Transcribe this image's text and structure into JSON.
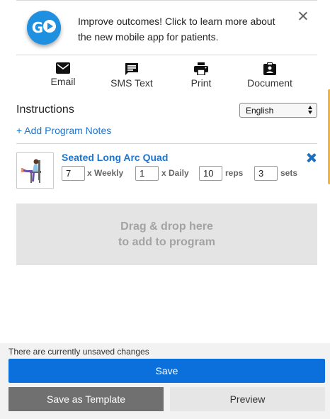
{
  "promo": {
    "badge_text": "GO",
    "text": "Improve outcomes! Click to learn more about the new mobile app for patients.",
    "close_icon": "close-icon"
  },
  "actions": [
    {
      "label": "Email",
      "icon": "email-icon"
    },
    {
      "label": "SMS Text",
      "icon": "sms-icon"
    },
    {
      "label": "Print",
      "icon": "print-icon"
    },
    {
      "label": "Document",
      "icon": "document-icon"
    }
  ],
  "instructions": {
    "title": "Instructions",
    "language": "English",
    "add_notes": "+ Add Program Notes"
  },
  "exercise": {
    "name": "Seated Long Arc Quad",
    "weekly": "7",
    "weekly_unit": "x Weekly",
    "daily": "1",
    "daily_unit": "x Daily",
    "reps": "10",
    "reps_unit": "reps",
    "sets": "3",
    "sets_unit": "sets"
  },
  "dropzone": {
    "line1": "Drag & drop here",
    "line2": "to add to program"
  },
  "footer": {
    "status": "There are currently unsaved changes",
    "save": "Save",
    "save_template": "Save as Template",
    "preview": "Preview"
  },
  "colors": {
    "accent_blue": "#0b6fdc",
    "link_blue": "#1f75cc",
    "badge_blue": "#1f8fe0",
    "side_accent": "#f2b441"
  }
}
